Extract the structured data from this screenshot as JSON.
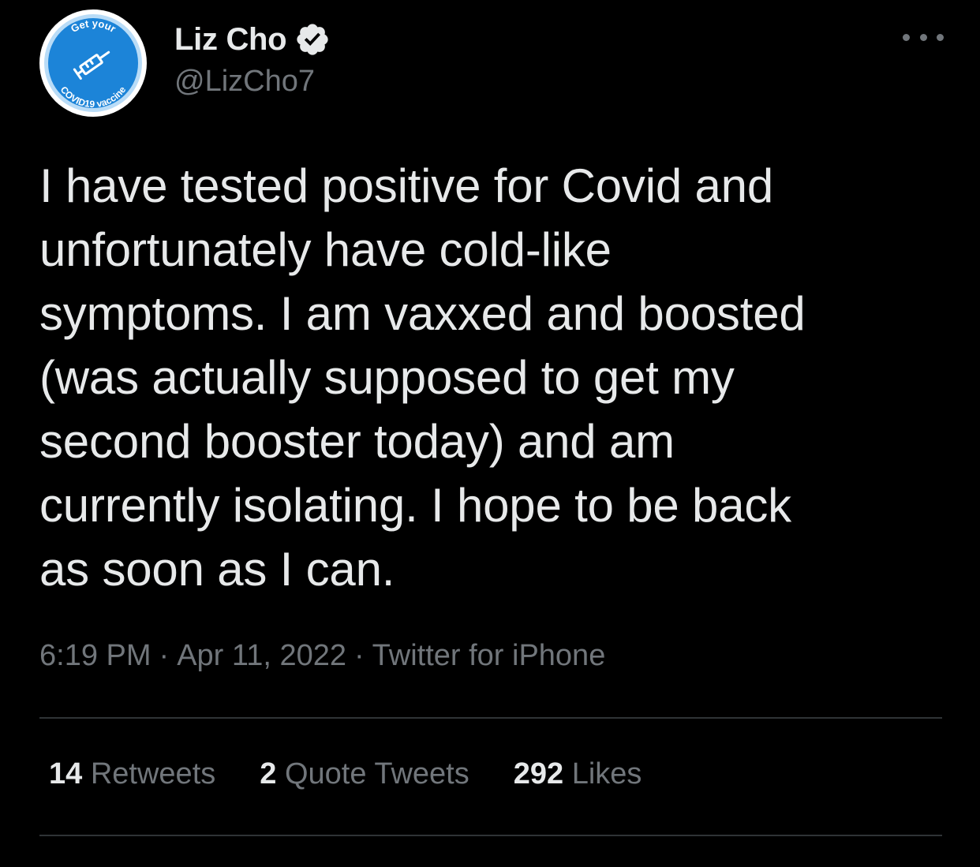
{
  "author": {
    "display_name": "Liz Cho",
    "handle": "@LizCho7",
    "verified": true,
    "avatar_badge_text_top": "Get your",
    "avatar_badge_text_bottom": "COVID19 vaccine",
    "avatar_icon": "syringe-icon"
  },
  "tweet": {
    "text": "I have tested positive for Covid and\nunfortunately have cold-like\nsymptoms. I am vaxxed and boosted\n(was actually supposed to get my\nsecond booster today) and am\ncurrently isolating. I hope to be back\nas soon as I can.",
    "time": "6:19 PM",
    "date": "Apr 11, 2022",
    "source": "Twitter for iPhone",
    "separator": "·"
  },
  "stats": {
    "retweets_count": "14",
    "retweets_label": "Retweets",
    "quote_tweets_count": "2",
    "quote_tweets_label": "Quote Tweets",
    "likes_count": "292",
    "likes_label": "Likes"
  },
  "icons": {
    "more": "more-icon",
    "verified": "verified-badge-icon"
  },
  "colors": {
    "background": "#000000",
    "text_primary": "#e7e9ea",
    "text_secondary": "#71767b",
    "divider": "#2f3336",
    "avatar_blue": "#1c84d8",
    "avatar_ring": "#b9dcf7"
  }
}
